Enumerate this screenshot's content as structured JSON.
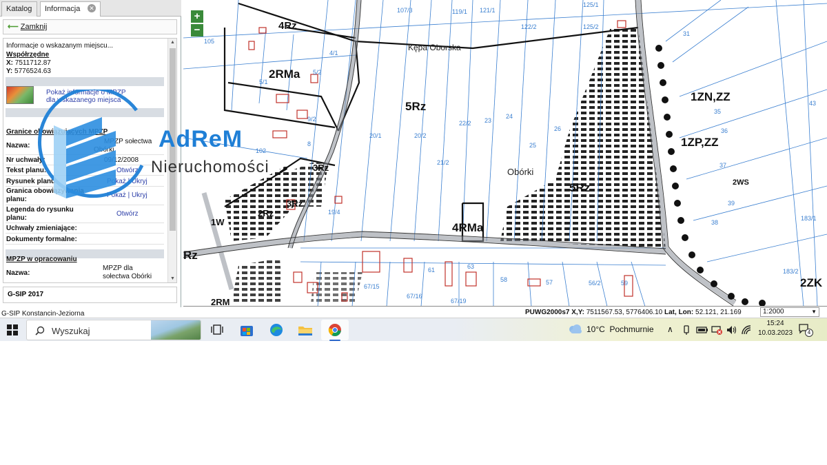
{
  "panel": {
    "tabs": [
      {
        "label": "Katalog"
      },
      {
        "label": "Informacja"
      }
    ],
    "tab_close": "⊗",
    "close_label": "Zamknij",
    "intro": "Informacje o wskazanym miejscu...",
    "coords_header": "Współrzędne",
    "x_label": "X:",
    "x_value": "7511712.87",
    "y_label": "Y:",
    "y_value": "5776524.63",
    "mpzp_link_1": "Pokaż informacje o MPZP",
    "mpzp_link_2": "dla wskazanego miejsca",
    "granice_header": "Granice obowiązujących MPZP",
    "rows": [
      {
        "label": "Nazwa:",
        "value": "MPZP sołectwa",
        "value2": "Obórki"
      },
      {
        "label": "Nr uchwały:",
        "value": "09/12/2008"
      },
      {
        "label": "Tekst planu:",
        "value": "Otwórz"
      },
      {
        "label": "Rysunek planu:",
        "value": "Pokaż | Ukryj"
      },
      {
        "label": "Granica obowiązywania",
        "label2": "planu:",
        "value": "Pokaż | Ukryj"
      },
      {
        "label": "Legenda do rysunku",
        "label2": "planu:",
        "value": "Otwórz"
      },
      {
        "label": "Uchwały zmieniające:",
        "value": ""
      },
      {
        "label": "Dokumenty formalne:",
        "value": ""
      }
    ],
    "w_opracowaniu_header": "MPZP w opracowaniu",
    "w_opracowaniu_name_label": "Nazwa:",
    "w_opracowaniu_name_1": "MPZP dla",
    "w_opracowaniu_name_2": "sołectwa Obórki",
    "footer": "G-SIP 2017"
  },
  "map": {
    "zoom_in": "+",
    "zoom_out": "−",
    "labels": {
      "l4rz": "4Rz",
      "l2rma": "2RMa",
      "l5rz": "5Rz",
      "l5rz2": "5Rz",
      "l4rma": "4RMa",
      "l1zn": "1ZN,ZZ",
      "l1zp": "1ZP,ZZ",
      "l2ws": "2WS",
      "l2zk": "2ZK",
      "l3rz": "3Rz",
      "l3rz2": "3Rz",
      "l2rz": "2Rz",
      "l1w": "1W",
      "lrz": "Rz",
      "l2rm": "2RM",
      "obork": "Obórki",
      "kepa": "Kępa Oborska"
    },
    "parcels": [
      "107/3",
      "119/1",
      "121/1",
      "122/2",
      "125/1",
      "125/2",
      "105",
      "5/2",
      "5/1",
      "9/2",
      "20/1",
      "20/2",
      "22/2",
      "23",
      "24",
      "25",
      "26",
      "21/2",
      "102",
      "19/4",
      "31",
      "35",
      "36",
      "37",
      "38",
      "39",
      "43",
      "183/1",
      "183/2",
      "67/15",
      "67/16",
      "67/19",
      "56/2",
      "57",
      "58",
      "59",
      "61",
      "63",
      "4/1",
      "8"
    ]
  },
  "status": {
    "app_name": "G-SIP Konstancin-Jeziorna",
    "coord_label": "PUWG2000s7 X,Y:",
    "coord_value": "7511567.53, 5776406.10",
    "latlon_label": "Lat, Lon:",
    "latlon_value": "52.121, 21.169",
    "scale": "1:2000"
  },
  "taskbar": {
    "search_placeholder": "Wyszukaj",
    "weather_temp": "10°C",
    "weather_desc": "Pochmurnie",
    "time": "15:24",
    "date": "10.03.2023",
    "notifications": "4"
  },
  "watermark": {
    "title": "AdReM",
    "subtitle": "Nieruchomości"
  },
  "colors": {
    "accent_green": "#3a8a3a",
    "link_blue": "#2d3fa8",
    "parcel_blue": "#3a7fd0",
    "watermark_blue": "#1f7fd6"
  }
}
